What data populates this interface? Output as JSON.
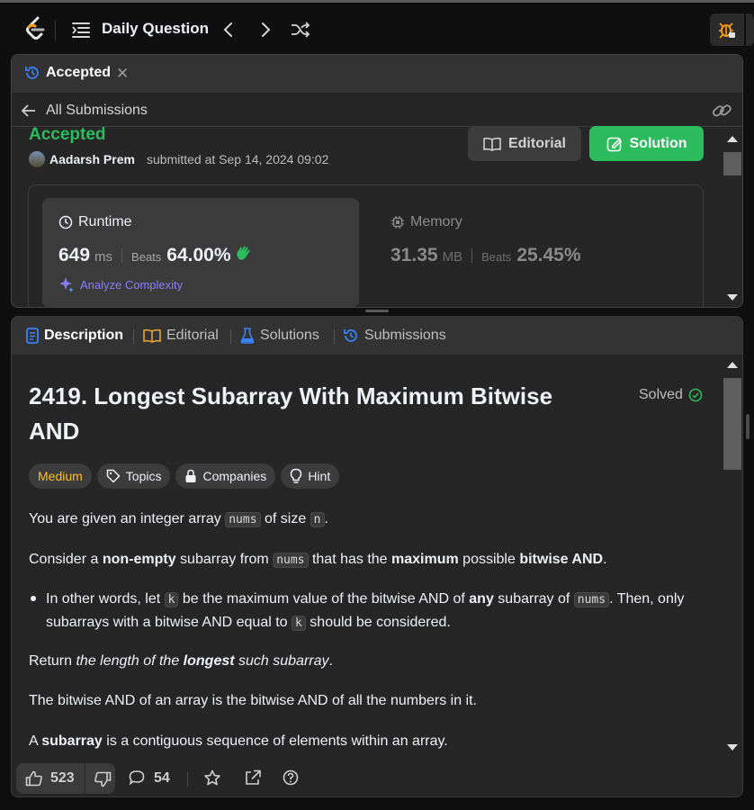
{
  "nav": {
    "title": "Daily Question",
    "icons": [
      "leetcode-logo",
      "problem-list-icon",
      "chevron-left-icon",
      "chevron-right-icon",
      "shuffle-icon",
      "debug-icon"
    ]
  },
  "submission_panel": {
    "tab_label": "Accepted",
    "back_label": "All Submissions",
    "status": "Accepted",
    "user": "Aadarsh Prem",
    "submitted_text": "submitted at Sep 14, 2024 09:02",
    "editorial_button": "Editorial",
    "solution_button": "Solution",
    "runtime": {
      "title": "Runtime",
      "value": "649",
      "unit": "ms",
      "beats_label": "Beats",
      "beats_value": "64.00%",
      "analyze_label": "Analyze Complexity"
    },
    "memory": {
      "title": "Memory",
      "value": "31.35",
      "unit": "MB",
      "beats_label": "Beats",
      "beats_value": "25.45%"
    }
  },
  "description_panel": {
    "tabs": [
      {
        "label": "Description"
      },
      {
        "label": "Editorial"
      },
      {
        "label": "Solutions"
      },
      {
        "label": "Submissions"
      }
    ],
    "title": "2419. Longest Subarray With Maximum Bitwise AND",
    "solved_label": "Solved",
    "pills": {
      "difficulty": "Medium",
      "topics": "Topics",
      "companies": "Companies",
      "hint": "Hint"
    },
    "p1": {
      "a": "You are given an integer array ",
      "code1": "nums",
      "b": " of size ",
      "code2": "n",
      "c": "."
    },
    "p2": {
      "a": "Consider a ",
      "b1": "non-empty",
      "c": " subarray from ",
      "code1": "nums",
      "d": " that has the ",
      "b2": "maximum",
      "e": " possible ",
      "b3": "bitwise AND",
      "f": "."
    },
    "bullet": {
      "a": "In other words, let ",
      "code1": "k",
      "b": " be the maximum value of the bitwise AND of ",
      "b1": "any",
      "c": " subarray of ",
      "code2": "nums",
      "d": ". Then, only subarrays with a bitwise AND equal to ",
      "code3": "k",
      "e": " should be considered."
    },
    "p3": {
      "a": "Return ",
      "i1": "the length of the ",
      "bi": "longest",
      "i2": " such subarray",
      "b": "."
    },
    "p4": "The bitwise AND of an array is the bitwise AND of all the numbers in it.",
    "p5": {
      "a": "A ",
      "b1": "subarray",
      "b": " is a contiguous sequence of elements within an array."
    },
    "footer": {
      "likes": "523",
      "comments": "54"
    }
  },
  "colors": {
    "accepted_green": "#2cbb5d",
    "medium_yellow": "#ffc01e",
    "analyze_purple": "#8a7dff",
    "tab_blue": "#3b82f6",
    "editorial_orange": "#e5a33a"
  }
}
